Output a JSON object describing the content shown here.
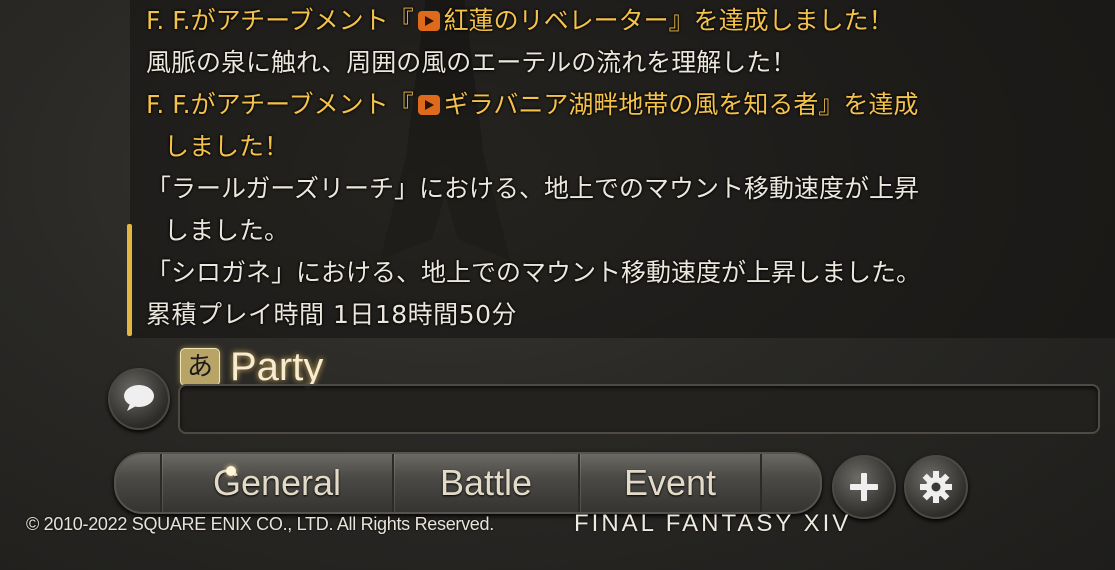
{
  "chat_log": {
    "lines": [
      {
        "type": "achievement",
        "pre": "F. F.がアチーブメント『",
        "name": "紅蓮のリベレーター",
        "post": "』を達成しました！"
      },
      {
        "type": "system",
        "text": "風脈の泉に触れ、周囲の風のエーテルの流れを理解した！"
      },
      {
        "type": "achievement",
        "pre": "F. F.がアチーブメント『",
        "name": "ギラバニア湖畔地帯の風を知る者",
        "post": "』を達成"
      },
      {
        "type": "achievement-cont",
        "text": "しました！"
      },
      {
        "type": "system",
        "text": "「ラールガーズリーチ」における、地上でのマウント移動速度が上昇"
      },
      {
        "type": "system-cont",
        "text": "しました。"
      },
      {
        "type": "system",
        "text": "「シロガネ」における、地上でのマウント移動速度が上昇しました。"
      },
      {
        "type": "system",
        "text": "累積プレイ時間 1日18時間50分"
      }
    ],
    "achievement_color": "#f4c24a",
    "system_color": "#ece7dc"
  },
  "input": {
    "ime_mode": "あ",
    "channel": "Party",
    "value": ""
  },
  "tabs": [
    {
      "label": "General",
      "active": true
    },
    {
      "label": "Battle",
      "active": false
    },
    {
      "label": "Event",
      "active": false
    }
  ],
  "buttons": {
    "chat_icon": "speech-bubble-icon",
    "add_icon": "plus-icon",
    "settings_icon": "gear-icon"
  },
  "footer": {
    "copyright": "© 2010-2022 SQUARE ENIX CO., LTD. All Rights Reserved.",
    "logo": "FINAL FANTASY XIV"
  }
}
